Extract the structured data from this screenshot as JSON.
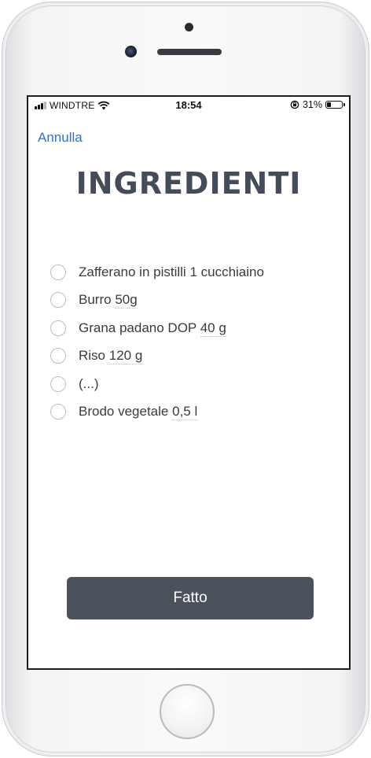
{
  "status_bar": {
    "carrier": "WINDTRE",
    "time": "18:54",
    "battery_percent": "31%",
    "battery_level": 0.31,
    "icons": [
      "signal-icon",
      "wifi-icon",
      "orientation-lock-icon",
      "battery-icon"
    ]
  },
  "header": {
    "cancel_label": "Annulla",
    "title": "INGREDIENTI"
  },
  "ingredients": [
    {
      "name": "Zafferano in pistilli",
      "quantity": "1 cucchiaino",
      "quantity_underlined": false
    },
    {
      "name": "Burro",
      "quantity": "50g",
      "quantity_underlined": true
    },
    {
      "name": "Grana padano DOP",
      "quantity": "40 g",
      "quantity_underlined": true
    },
    {
      "name": "Riso",
      "quantity": "120 g",
      "quantity_underlined": true
    },
    {
      "name": "(...)",
      "quantity": "",
      "quantity_underlined": false
    },
    {
      "name": "Brodo vegetale",
      "quantity": "0,5 l",
      "quantity_underlined": true
    }
  ],
  "footer": {
    "done_label": "Fatto"
  },
  "colors": {
    "accent_link": "#2f6fd1",
    "title": "#444c59",
    "button_bg": "#4b525c"
  }
}
